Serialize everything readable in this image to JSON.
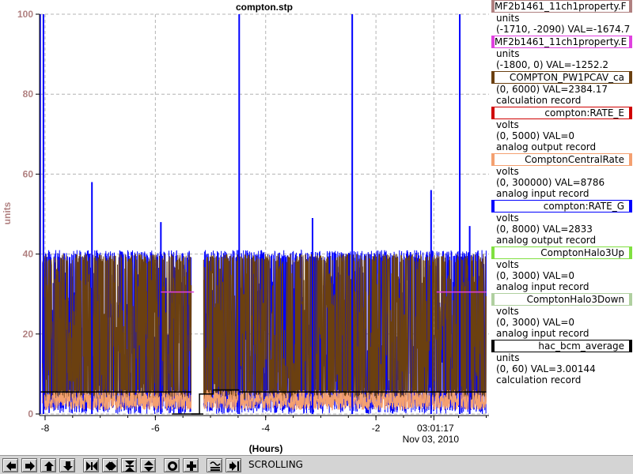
{
  "chart_data": {
    "type": "line",
    "title": "compton.stp",
    "xlabel": "(Hours)",
    "ylabel": "units",
    "xlim": [
      -8.1,
      0.05
    ],
    "ylim": [
      0,
      100
    ],
    "x_ticks": [
      -8,
      -6,
      -4,
      -2
    ],
    "x_tick_labels": [
      "-8",
      "-6",
      "-4",
      "-2"
    ],
    "y_ticks": [
      0,
      20,
      40,
      60,
      80,
      100
    ],
    "y_tick_labels": [
      "0",
      "20",
      "40",
      "60",
      "80",
      "100"
    ],
    "time_marker": {
      "x": -0.95,
      "time": "03:01:17",
      "date": "Nov 03, 2010"
    },
    "grid": true,
    "series": [
      {
        "name": "MF2b1461_11ch1property.E",
        "color": "#e040e0",
        "style": "flat",
        "segments": [
          [
            -5.9,
            -5.3,
            30.5
          ],
          [
            -0.9,
            0.0,
            30.5
          ]
        ]
      },
      {
        "name": "COMPTON_PW1PCAV_ca",
        "color": "#6b4010",
        "style": "noise",
        "base": 3,
        "spread": 37,
        "cap": 40
      },
      {
        "name": "ComptonCentralRate",
        "color": "#f4a070",
        "style": "noise",
        "base": 1,
        "spread": 4,
        "cap": 6
      },
      {
        "name": "compton:RATE_G",
        "color": "#0000ff",
        "style": "noise",
        "base": 0,
        "spread": 38,
        "cap": 41,
        "spikes": [
          [
            -8.03,
            100
          ],
          [
            -7.15,
            58
          ],
          [
            -5.9,
            48
          ],
          [
            -4.48,
            100
          ],
          [
            -3.15,
            49
          ],
          [
            -2.43,
            100
          ],
          [
            -1.0,
            56
          ],
          [
            -0.48,
            100
          ],
          [
            -0.3,
            47
          ]
        ]
      },
      {
        "name": "hac_bcm_average",
        "color": "#000000",
        "style": "flat",
        "segments": [
          [
            -8.1,
            -5.35,
            5.5
          ],
          [
            -5.2,
            -4.95,
            5
          ],
          [
            -4.95,
            -4.5,
            6
          ],
          [
            -4.48,
            0.0,
            5.5
          ]
        ]
      }
    ],
    "gaps": [
      [
        -5.35,
        -5.13
      ]
    ],
    "gap_level": 0,
    "black_step": [
      [
        -5.35,
        0.0
      ],
      [
        -5.2,
        0.0
      ],
      [
        -5.2,
        5.0
      ],
      [
        -4.95,
        5.0
      ],
      [
        -4.95,
        6.0
      ],
      [
        -4.48,
        6.0
      ]
    ]
  },
  "legend": [
    {
      "name": "MF2b1461_11ch1property.F",
      "color": "#b08080",
      "lines": [
        "units",
        "(-1710, -2090) VAL=-1674.7"
      ]
    },
    {
      "name": "MF2b1461_11ch1property.E",
      "color": "#e040e0",
      "lines": [
        "units",
        "(-1800, 0) VAL=-1252.2"
      ]
    },
    {
      "name": "COMPTON_PW1PCAV_ca",
      "color": "#6b4010",
      "lines": [
        "(0, 6000) VAL=2384.17",
        "calculation record"
      ]
    },
    {
      "name": "compton:RATE_E",
      "color": "#d00000",
      "lines": [
        "volts",
        "(0, 5000) VAL=0",
        "analog output record"
      ]
    },
    {
      "name": "ComptonCentralRate",
      "color": "#f4a070",
      "lines": [
        "volts",
        "(0, 300000) VAL=8786",
        "analog input record"
      ]
    },
    {
      "name": "compton:RATE_G",
      "color": "#0000ff",
      "lines": [
        "volts",
        "(0, 8000) VAL=2833",
        "analog output record"
      ]
    },
    {
      "name": "ComptonHalo3Up",
      "color": "#80e040",
      "lines": [
        "volts",
        "(0, 3000) VAL=0",
        "analog input record"
      ]
    },
    {
      "name": "ComptonHalo3Down",
      "color": "#b0d0a0",
      "lines": [
        "volts",
        "(0, 3000) VAL=0",
        "analog input record"
      ]
    },
    {
      "name": "hac_bcm_average",
      "color": "#000000",
      "lines": [
        "units",
        "(0, 60) VAL=3.00144",
        "calculation record"
      ]
    }
  ],
  "toolbar": {
    "status": "SCROLLING",
    "buttons": [
      {
        "name": "scroll-left-button",
        "icon": "arrow-left-icon"
      },
      {
        "name": "scroll-right-button",
        "icon": "arrow-right-icon"
      },
      {
        "name": "scroll-up-button",
        "icon": "arrow-up-icon"
      },
      {
        "name": "scroll-down-button",
        "icon": "arrow-down-icon"
      },
      {
        "name": "zoom-in-x-button",
        "icon": "zoom-in-x-icon"
      },
      {
        "name": "zoom-out-x-button",
        "icon": "zoom-out-x-icon"
      },
      {
        "name": "zoom-in-y-button",
        "icon": "zoom-in-y-icon"
      },
      {
        "name": "zoom-out-y-button",
        "icon": "zoom-out-y-icon"
      },
      {
        "name": "reset-button",
        "icon": "circle-icon"
      },
      {
        "name": "add-button",
        "icon": "plus-icon"
      },
      {
        "name": "autoscale-button",
        "icon": "autoscale-icon"
      },
      {
        "name": "jump-to-end-button",
        "icon": "jump-end-icon"
      }
    ]
  }
}
